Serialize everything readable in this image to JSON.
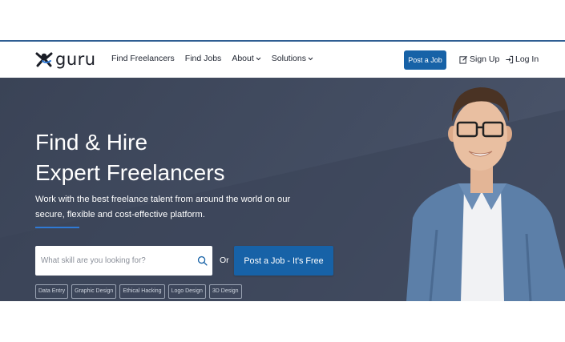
{
  "brand": {
    "name": "guru"
  },
  "nav": {
    "links": [
      {
        "label": "Find Freelancers",
        "has_chevron": false
      },
      {
        "label": "Find Jobs",
        "has_chevron": false
      },
      {
        "label": "About",
        "has_chevron": true
      },
      {
        "label": "Solutions",
        "has_chevron": true
      }
    ],
    "post_job": "Post a Job",
    "sign_up": "Sign Up",
    "log_in": "Log In"
  },
  "hero": {
    "title_line1": "Find & Hire",
    "title_line2": "Expert Freelancers",
    "subtitle": "Work with the best freelance talent from around the world on our secure, flexible and cost-effective platform.",
    "search_placeholder": "What skill are you looking for?",
    "or_label": "Or",
    "cta": "Post a Job - It's Free",
    "tags": [
      "Data Entry",
      "Graphic Design",
      "Ethical Hacking",
      "Logo Design",
      "3D Design"
    ]
  },
  "icons": {
    "logo": "guru-logo-icon",
    "search": "search-icon",
    "sign_up": "edit-icon",
    "log_in": "login-icon",
    "chevron": "chevron-down-icon"
  },
  "colors": {
    "primary": "#1762a7",
    "hero_bg": "#3f4859",
    "accent_rule": "#2f7ad6",
    "text_dark": "#1f2430"
  }
}
